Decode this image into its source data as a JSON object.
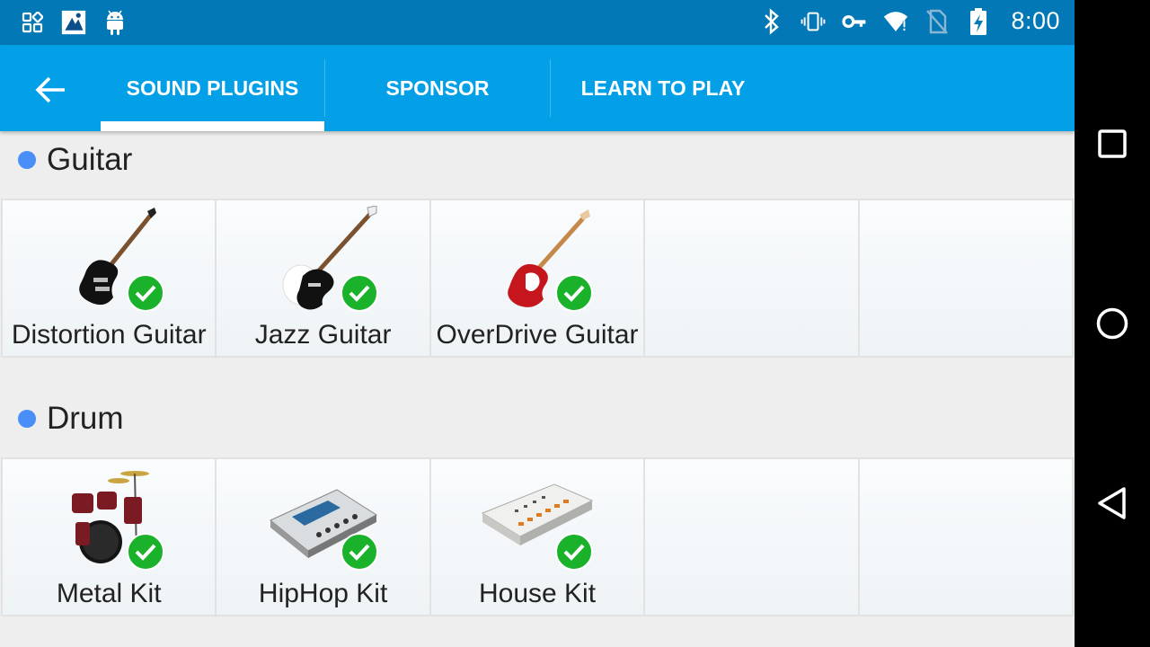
{
  "status_bar": {
    "left_icons": [
      "apps-grid-icon",
      "image-notification-icon",
      "android-icon"
    ],
    "right_icons": [
      "bluetooth-icon",
      "vibrate-icon",
      "vpn-key-icon",
      "wifi-icon",
      "no-sim-icon",
      "battery-charging-icon"
    ],
    "time": "8:00"
  },
  "app_bar": {
    "back_icon": "arrow-back-icon",
    "tabs": [
      {
        "label": "SOUND PLUGINS",
        "selected": true
      },
      {
        "label": "SPONSOR",
        "selected": false
      },
      {
        "label": "LEARN TO PLAY",
        "selected": false
      }
    ]
  },
  "sections": [
    {
      "title": "Guitar",
      "items": [
        {
          "label": "Distortion Guitar",
          "icon": "electric-guitar-black",
          "installed": true
        },
        {
          "label": "Jazz Guitar",
          "icon": "electric-guitar-black-white",
          "installed": true
        },
        {
          "label": "OverDrive Guitar",
          "icon": "electric-guitar-red",
          "installed": true
        }
      ]
    },
    {
      "title": "Drum",
      "items": [
        {
          "label": "Metal Kit",
          "icon": "drum-kit",
          "installed": true
        },
        {
          "label": "HipHop Kit",
          "icon": "drum-machine-silver",
          "installed": true
        },
        {
          "label": "House Kit",
          "icon": "drum-machine-white",
          "installed": true
        }
      ]
    }
  ],
  "colors": {
    "status_bar": "#0278b7",
    "app_bar": "#03a0e8",
    "section_dot": "#4a8ff7",
    "check_badge": "#1ab22b"
  },
  "nav_bar": {
    "buttons": [
      "recents-square-icon",
      "home-circle-icon",
      "back-triangle-icon"
    ]
  }
}
